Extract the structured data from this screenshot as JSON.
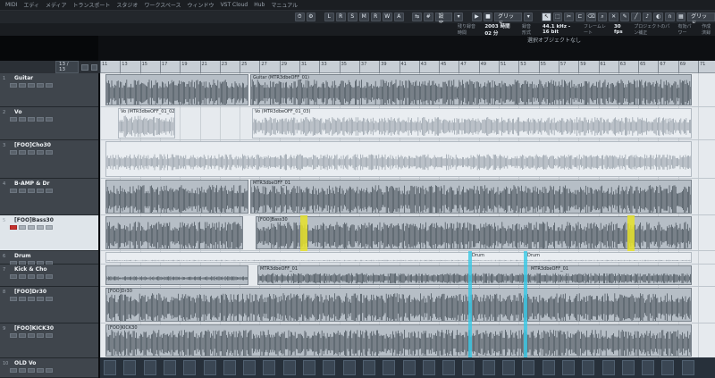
{
  "menu": [
    "MIDI",
    "エディ",
    "メディア",
    "トランスポート",
    "スタジオ",
    "ワークスペース",
    "ウィンドウ",
    "VST Cloud",
    "Hub",
    "マニュアル"
  ],
  "toolbar": {
    "mode_buttons": [
      "L",
      "R",
      "S",
      "M",
      "R",
      "W",
      "A"
    ],
    "preset": "設定",
    "snap_type": "グリッド",
    "snap_mode": "グリッド"
  },
  "infobar": {
    "record_time_label": "残り録音時間",
    "record_time": "2003 時間 02 分",
    "format_label": "録音形式",
    "format": "44.1 kHz - 16 bit",
    "frame_label": "フレームレート",
    "frame": "30 fps",
    "pan_label": "プロジェクトのパン補正",
    "power_label": "有効パワー",
    "tempo_label": "作成済録"
  },
  "selection_label": "選択オブジェクトなし",
  "track_counter": "13 / 13",
  "ruler_start": 11,
  "ruler_labels": [
    "11",
    "13",
    "15",
    "17",
    "19",
    "21",
    "23",
    "25",
    "27",
    "29",
    "31",
    "33",
    "35",
    "37",
    "39",
    "41",
    "43",
    "45",
    "47",
    "49",
    "51",
    "53",
    "55",
    "57",
    "59",
    "61",
    "63",
    "65",
    "67",
    "69",
    "71"
  ],
  "tracks": [
    {
      "name": "Guitar",
      "height": 38
    },
    {
      "name": "Vo",
      "height": 37
    },
    {
      "name": "[FOO]Cho30",
      "height": 43
    },
    {
      "name": "B-AMP & Dr",
      "height": 41
    },
    {
      "name": "[FOO]Bass30",
      "height": 40
    },
    {
      "name": "Drum",
      "height": 15
    },
    {
      "name": "Kick & Cho",
      "height": 25
    },
    {
      "name": "[FOO]Dr30",
      "height": 41
    },
    {
      "name": "[FOO]KICK30",
      "height": 39
    },
    {
      "name": "OLD Vo",
      "height": 22
    }
  ],
  "events": {
    "guitar": "Guitar (MTR3dbeOFF_01)",
    "vo_a": "Vo (MTR3dbeOFF_01_02)",
    "vo_b": "Vo (MTR3dbeOFF_01_03)",
    "bamp": "MTR3dbeOFF_01",
    "bass": "[FOO]Bass30",
    "drum": "Drum",
    "kick_a": "MTR3dbeOFF_01",
    "kick_b": "MTR3dbeOFF_01",
    "dr": "[FOO]Dr30",
    "kick30": "[FOO]KICK30"
  }
}
